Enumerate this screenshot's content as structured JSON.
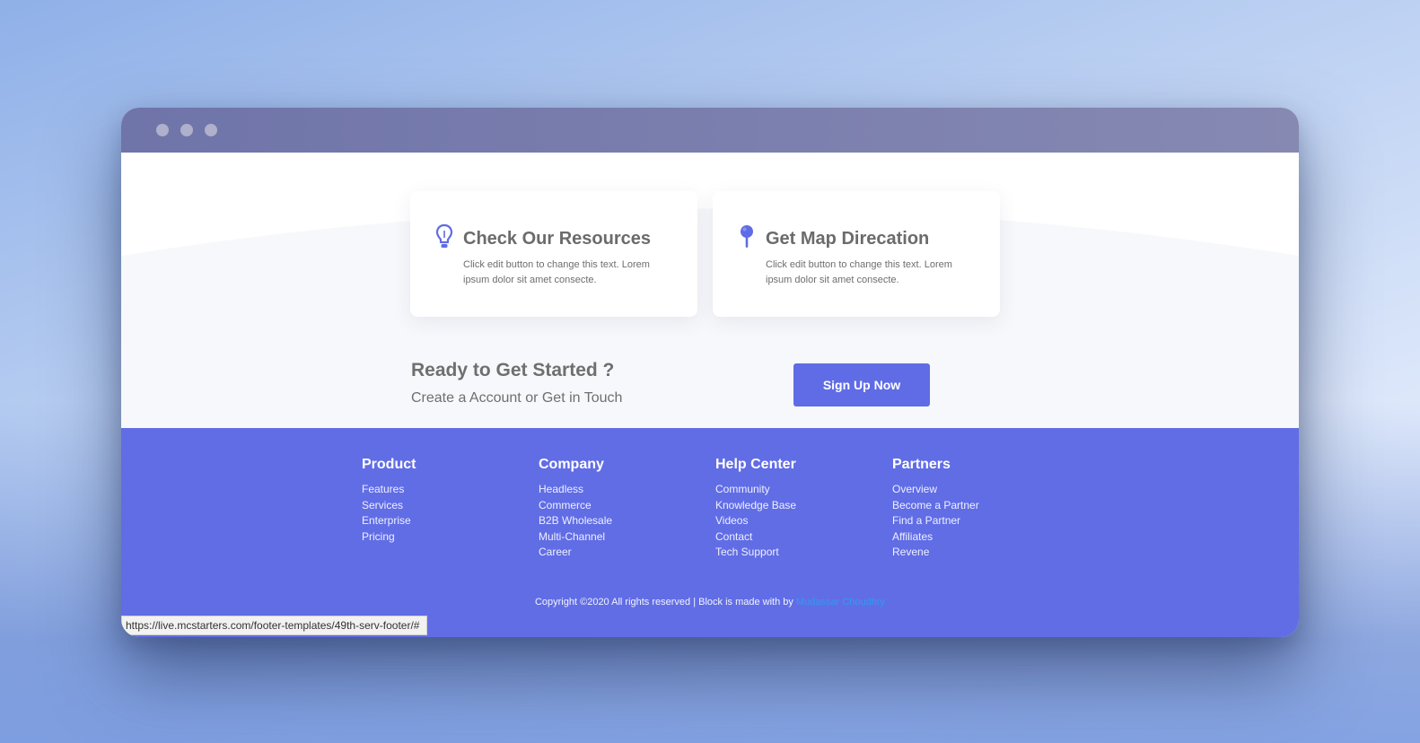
{
  "window": {
    "dots": [
      "",
      "",
      ""
    ]
  },
  "cards": [
    {
      "title": "Check Our Resources",
      "text": "Click edit button to change this text. Lorem ipsum dolor sit amet consecte.",
      "icon": "lightbulb-icon"
    },
    {
      "title": "Get Map Direcation",
      "text": "Click edit button to change this text. Lorem ipsum dolor sit amet consecte.",
      "icon": "map-pin-icon"
    }
  ],
  "cta": {
    "title": "Ready to Get Started ?",
    "subtitle": "Create a Account or Get in Touch",
    "button": "Sign Up Now"
  },
  "footer": {
    "columns": [
      {
        "heading": "Product",
        "links": [
          "Features",
          "Services",
          "Enterprise",
          "Pricing"
        ]
      },
      {
        "heading": "Company",
        "links": [
          "Headless",
          "Commerce",
          "B2B Wholesale",
          "Multi-Channel",
          "Career"
        ]
      },
      {
        "heading": "Help Center",
        "links": [
          "Community",
          "Knowledge Base",
          "Videos",
          "Contact",
          "Tech Support"
        ]
      },
      {
        "heading": "Partners",
        "links": [
          "Overview",
          "Become a Partner",
          "Find a Partner",
          "Affiliates",
          "Revene"
        ]
      }
    ],
    "copyright": "Copyright ©2020 All rights reserved | Block is made with by",
    "author": "Mudassar Choudhry"
  },
  "status_url": "https://live.mcstarters.com/footer-templates/49th-serv-footer/#",
  "colors": {
    "accent": "#5f6ce6",
    "footer_bg": "#616de5",
    "titlebar": "#7b7fae",
    "author_link": "#2f9bf0"
  }
}
